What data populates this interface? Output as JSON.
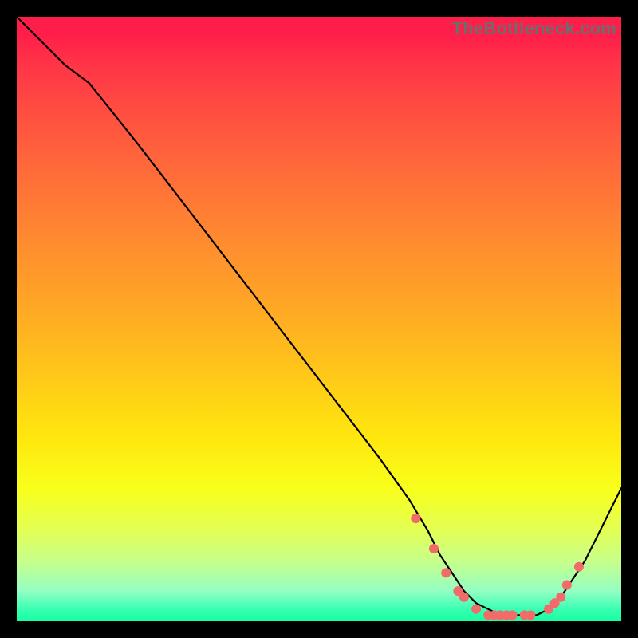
{
  "watermark": "TheBottleneck.com",
  "chart_data": {
    "type": "line",
    "title": "",
    "xlabel": "",
    "ylabel": "",
    "xlim": [
      0,
      100
    ],
    "ylim": [
      0,
      100
    ],
    "grid": false,
    "legend": false,
    "series": [
      {
        "name": "curve",
        "x": [
          0,
          8,
          12,
          20,
          30,
          40,
          50,
          60,
          65,
          68,
          70,
          72,
          74,
          76,
          78,
          80,
          82,
          84,
          86,
          88,
          90,
          92,
          94,
          96,
          98,
          100
        ],
        "values": [
          100,
          92,
          89,
          79,
          66,
          53,
          40,
          27,
          20,
          15,
          11,
          8,
          5,
          3,
          2,
          1,
          1,
          1,
          1,
          2,
          4,
          7,
          10,
          14,
          18,
          22
        ]
      }
    ],
    "data_points": {
      "name": "highlighted-points",
      "x": [
        66,
        69,
        71,
        73,
        74,
        76,
        78,
        79,
        80,
        81,
        82,
        84,
        85,
        88,
        89,
        90,
        91,
        93
      ],
      "values": [
        17,
        12,
        8,
        5,
        4,
        2,
        1,
        1,
        1,
        1,
        1,
        1,
        1,
        2,
        3,
        4,
        6,
        9
      ],
      "color": "#f26a6a"
    },
    "background_gradient": {
      "direction": "vertical",
      "stops": [
        {
          "pos": 0,
          "color": "#ff1e4a"
        },
        {
          "pos": 50,
          "color": "#ffb820"
        },
        {
          "pos": 80,
          "color": "#f2ff30"
        },
        {
          "pos": 100,
          "color": "#15ff9f"
        }
      ]
    }
  }
}
